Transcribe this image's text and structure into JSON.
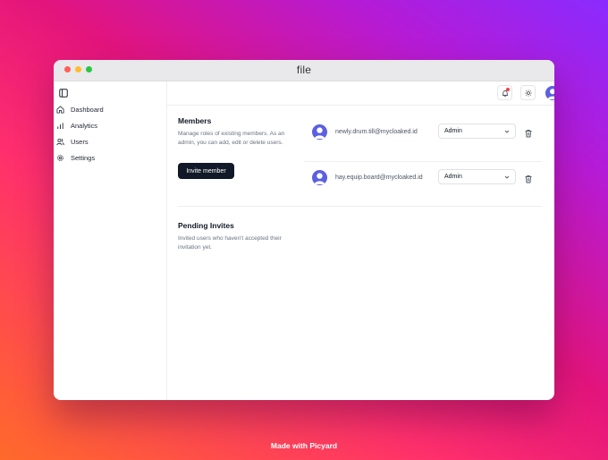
{
  "window": {
    "title": "file"
  },
  "sidebar": {
    "toggle_icon": "sidebar-toggle-icon",
    "items": [
      {
        "label": "Dashboard",
        "icon": "home-icon"
      },
      {
        "label": "Analytics",
        "icon": "bar-chart-icon"
      },
      {
        "label": "Users",
        "icon": "users-icon"
      },
      {
        "label": "Settings",
        "icon": "gear-icon"
      }
    ]
  },
  "topbar": {
    "icons": [
      "bell-icon",
      "sun-icon",
      "avatar"
    ],
    "notification_dot_color": "#ef4444"
  },
  "members": {
    "title": "Members",
    "description": "Manage roles of existing members. As an admin, you can add, edit or delete users.",
    "invite_label": "Invite member",
    "list": [
      {
        "email": "newly.drum.till@mycloaked.id",
        "role": "Admin"
      },
      {
        "email": "hay.equip.board@mycloaked.id",
        "role": "Admin"
      }
    ]
  },
  "pending": {
    "title": "Pending Invites",
    "description": "Invited users who haven't accepted their invitation yet."
  },
  "footer": {
    "text": "Made with Picyard"
  },
  "colors": {
    "accent": "#111827",
    "avatar": "#5b5fe0",
    "muted_text": "#6b7280"
  }
}
